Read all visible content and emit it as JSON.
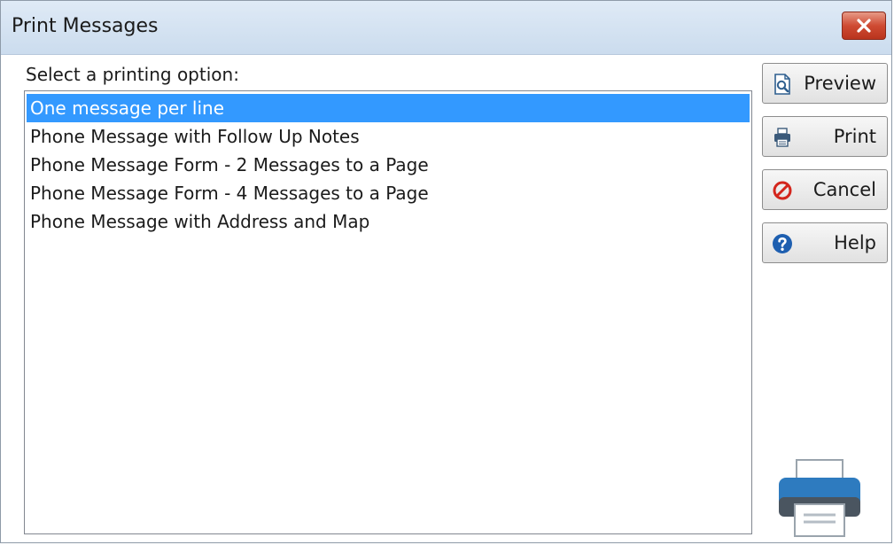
{
  "window": {
    "title": "Print Messages",
    "close_icon": "close-icon"
  },
  "prompt": "Select a printing option:",
  "list": {
    "selected_index": 0,
    "items": [
      "One message per line",
      "Phone Message with Follow Up Notes",
      "Phone Message Form - 2 Messages to a Page",
      "Phone Message Form - 4 Messages to a Page",
      "Phone Message with Address and Map"
    ]
  },
  "buttons": {
    "preview": {
      "label": "Preview",
      "icon": "preview-icon"
    },
    "print": {
      "label": "Print",
      "icon": "printer-icon"
    },
    "cancel": {
      "label": "Cancel",
      "icon": "cancel-icon"
    },
    "help": {
      "label": "Help",
      "icon": "help-icon"
    }
  },
  "colors": {
    "selection": "#3399ff",
    "close_button": "#cf4b33",
    "printer_accent": "#2e7bbf"
  }
}
